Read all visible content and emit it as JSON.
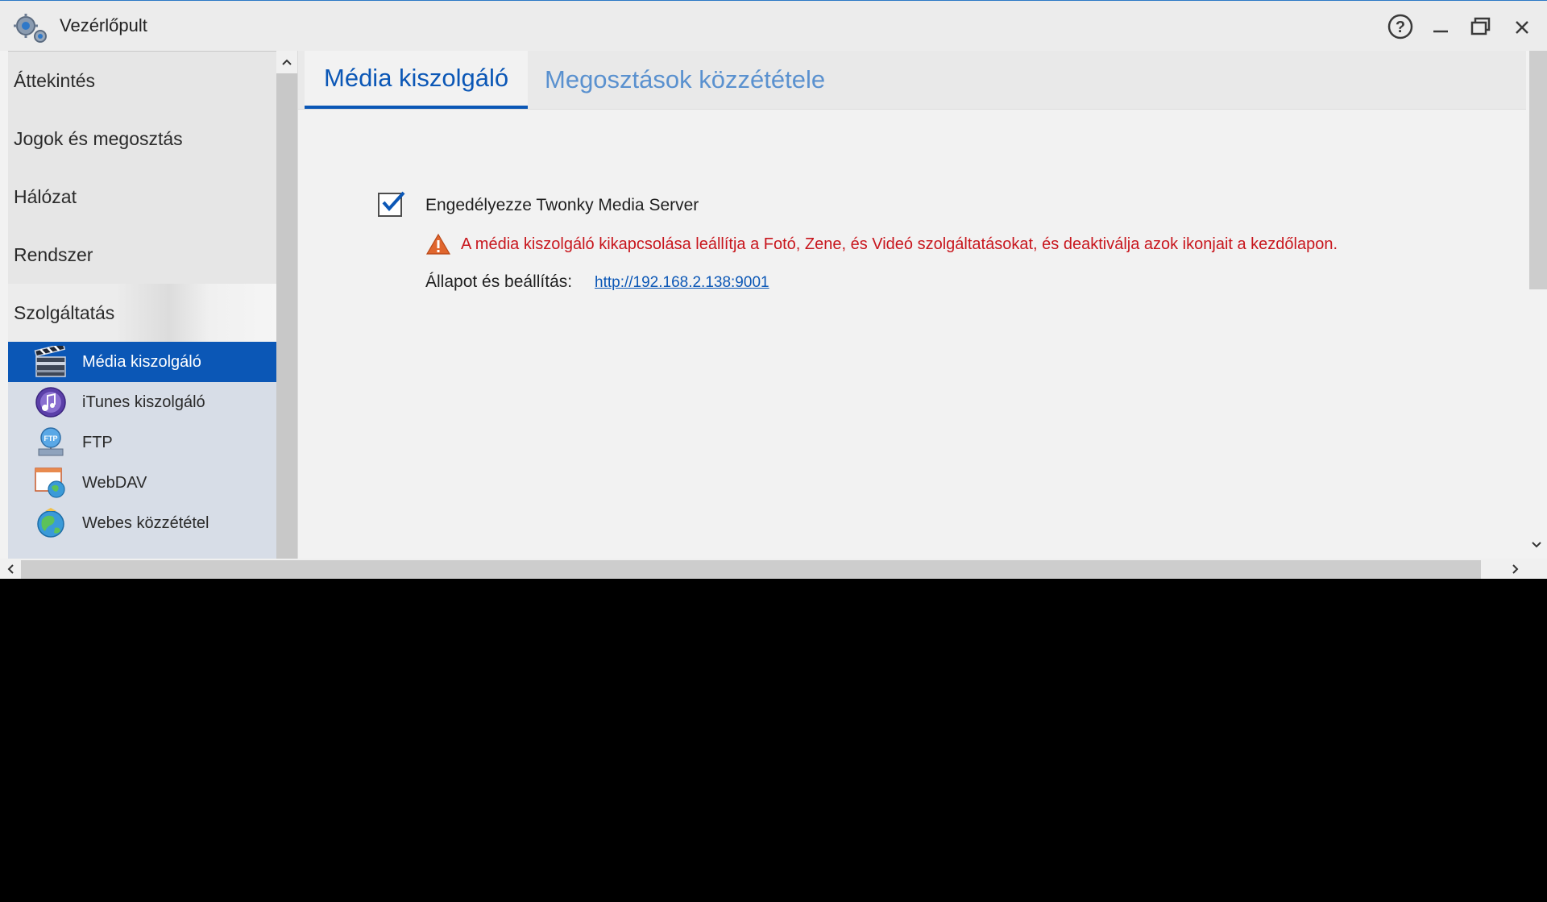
{
  "window": {
    "title": "Vezérlőpult",
    "app_icon": "gears-icon",
    "buttons": [
      "help-icon",
      "minimize-icon",
      "maximize-icon",
      "close-icon"
    ]
  },
  "sidebar": {
    "items": [
      {
        "label": "Áttekintés"
      },
      {
        "label": "Jogok és megosztás"
      },
      {
        "label": "Hálózat"
      },
      {
        "label": "Rendszer"
      },
      {
        "label": "Szolgáltatás"
      }
    ],
    "sub_items": [
      {
        "label": "Média kiszolgáló",
        "icon": "clapperboard-icon"
      },
      {
        "label": "iTunes kiszolgáló",
        "icon": "music-note-icon"
      },
      {
        "label": "FTP",
        "icon": "ftp-icon"
      },
      {
        "label": "WebDAV",
        "icon": "webdav-globe-icon"
      },
      {
        "label": "Webes közzététel",
        "icon": "globe-icon"
      }
    ]
  },
  "tabs": [
    {
      "label": "Média kiszolgáló"
    },
    {
      "label": "Megosztások közzététele"
    }
  ],
  "main": {
    "enable_label": "Engedélyezze Twonky Media Server",
    "enable_checked": true,
    "warning_text": "A média kiszolgáló kikapcsolása leállítja a Fotó, Zene, és Videó szolgáltatásokat, és deaktiválja azok ikonjait a kezdőlapon.",
    "status_label": "Állapot és beállítás:",
    "status_link": "http://192.168.2.138:9001"
  },
  "colors": {
    "accent": "#0b57b6",
    "warning": "#c8161d",
    "link": "#0b57b6"
  }
}
